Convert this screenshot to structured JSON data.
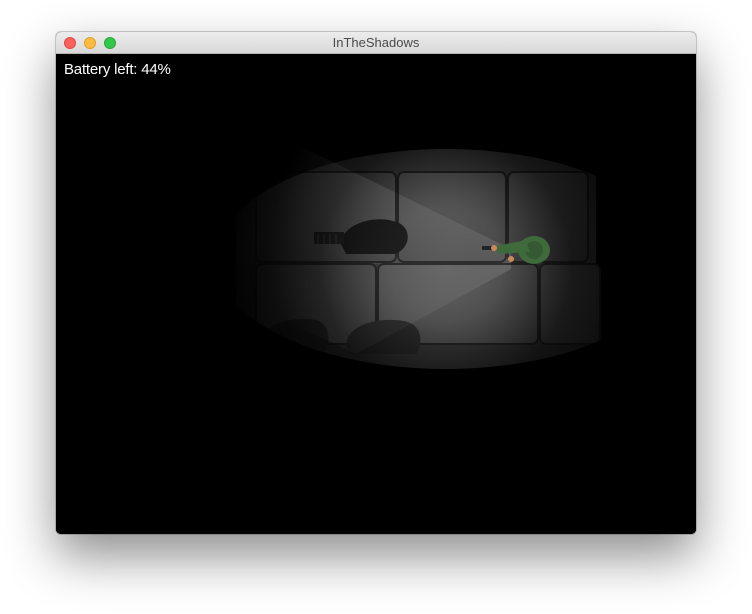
{
  "window": {
    "title": "InTheShadows"
  },
  "hud": {
    "battery_label": "Battery left: 44%"
  },
  "game": {
    "battery_percent": 44,
    "flashlight_on": true,
    "colors": {
      "background": "#000000",
      "stone": "#6e6e6e",
      "player_body": "#3f6a3c",
      "player_hand": "#c98a5a"
    }
  }
}
